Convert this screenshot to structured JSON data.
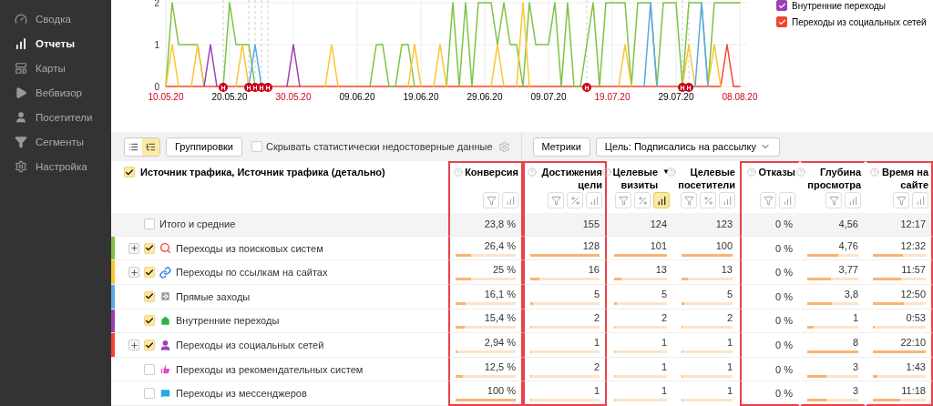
{
  "sidebar": {
    "items": [
      {
        "label": "Сводка",
        "kind": "gauge",
        "selected": false
      },
      {
        "label": "Отчеты",
        "kind": "reports",
        "selected": true
      },
      {
        "label": "Карты",
        "kind": "maps",
        "selected": false
      },
      {
        "label": "Вебвизор",
        "kind": "player",
        "selected": false
      },
      {
        "label": "Посетители",
        "kind": "visitors",
        "selected": false
      },
      {
        "label": "Сегменты",
        "kind": "segments",
        "selected": false
      },
      {
        "label": "Настройка",
        "kind": "settings",
        "selected": false
      }
    ]
  },
  "chart": {
    "chart_data": {
      "type": "line",
      "categories": [
        "10.05.20",
        null,
        null,
        null,
        null,
        null,
        null,
        null,
        null,
        null,
        "20.05.20",
        null,
        null,
        null,
        null,
        null,
        null,
        null,
        null,
        null,
        "30.05.20",
        null,
        null,
        null,
        null,
        null,
        null,
        null,
        null,
        null,
        "09.06.20",
        null,
        null,
        null,
        null,
        null,
        null,
        null,
        null,
        null,
        "19.06.20",
        null,
        null,
        null,
        null,
        null,
        null,
        null,
        null,
        null,
        "29.06.20",
        null,
        null,
        null,
        null,
        null,
        null,
        null,
        null,
        null,
        "09.07.20",
        null,
        null,
        null,
        null,
        null,
        null,
        null,
        null,
        null,
        "19.07.20",
        null,
        null,
        null,
        null,
        null,
        null,
        null,
        null,
        null,
        "29.07.20",
        null,
        null,
        null,
        null,
        null,
        null,
        null,
        null,
        null,
        "08.08.20"
      ],
      "ylim": [
        0,
        2
      ],
      "yticks": [
        0,
        1,
        2
      ],
      "series": [
        {
          "color": "#f4442e",
          "values": [
            0,
            0,
            0,
            0,
            0,
            0,
            0,
            0,
            0,
            0,
            0,
            0,
            0,
            0,
            0,
            0,
            0,
            0,
            0,
            0,
            0,
            0,
            0,
            0,
            0,
            0,
            0,
            0,
            0,
            0,
            0,
            0,
            0,
            0,
            0,
            0,
            0,
            0,
            0,
            0,
            0,
            0,
            0,
            0,
            0,
            0,
            0,
            0,
            0,
            0,
            0,
            0,
            0,
            0,
            0,
            0,
            0,
            0,
            0,
            0,
            0,
            0,
            0,
            0,
            0,
            0,
            0,
            0,
            0,
            0,
            0,
            0,
            0,
            0,
            0,
            0,
            0,
            0,
            0,
            0,
            0,
            0,
            0,
            0,
            0,
            0,
            0,
            0,
            1,
            0,
            0
          ]
        },
        {
          "color": "#7dc242",
          "values": [
            0,
            2,
            1,
            1,
            1,
            1,
            0,
            null,
            null,
            0,
            2,
            1,
            1,
            1,
            0,
            null,
            null,
            null,
            null,
            null,
            null,
            null,
            null,
            null,
            null,
            null,
            null,
            null,
            null,
            null,
            null,
            null,
            0,
            1,
            1,
            0,
            0,
            1,
            1,
            0,
            null,
            null,
            null,
            null,
            0,
            2,
            0,
            2,
            0,
            2,
            2,
            2,
            1,
            2,
            1,
            1,
            0,
            2,
            1,
            1,
            1,
            2,
            0,
            2,
            0,
            0,
            1,
            2,
            0,
            2,
            2,
            2,
            2,
            0,
            2,
            2,
            2,
            0,
            2,
            2,
            2,
            0,
            2,
            2,
            2,
            0,
            2,
            2,
            2,
            2,
            2
          ]
        },
        {
          "color": "#fcc52d",
          "values": [
            0,
            1,
            0,
            null,
            0,
            1,
            0,
            null,
            null,
            null,
            null,
            0,
            1,
            0,
            null,
            null,
            null,
            null,
            null,
            null,
            null,
            null,
            null,
            null,
            null,
            0,
            1,
            0,
            null,
            null,
            null,
            null,
            null,
            null,
            null,
            null,
            null,
            null,
            0,
            1,
            0,
            null,
            0,
            1,
            0,
            null,
            null,
            null,
            null,
            null,
            null,
            0,
            1,
            0,
            null,
            0,
            2,
            0,
            null,
            null,
            null,
            null,
            null,
            null,
            null,
            null,
            null,
            null,
            null,
            null,
            null,
            0,
            1,
            0,
            null,
            null,
            null,
            null,
            null,
            null,
            null,
            0,
            1,
            0,
            null,
            0,
            1,
            0,
            null,
            null,
            null
          ]
        },
        {
          "color": "#5aa9e6",
          "values": [
            null,
            null,
            null,
            null,
            null,
            null,
            null,
            null,
            null,
            null,
            null,
            null,
            null,
            0,
            1,
            0,
            null,
            null,
            null,
            null,
            null,
            null,
            null,
            null,
            null,
            null,
            null,
            null,
            null,
            null,
            null,
            null,
            null,
            null,
            null,
            null,
            null,
            null,
            null,
            null,
            null,
            null,
            null,
            null,
            null,
            null,
            null,
            null,
            null,
            null,
            null,
            null,
            null,
            null,
            null,
            null,
            null,
            null,
            null,
            null,
            null,
            null,
            null,
            null,
            null,
            null,
            null,
            null,
            null,
            null,
            null,
            null,
            null,
            null,
            null,
            0,
            2,
            0,
            null,
            null,
            null,
            null,
            null,
            0,
            2,
            0,
            null,
            null,
            null,
            null,
            null
          ]
        },
        {
          "type": "scatter",
          "color": "#c8001a",
          "values": [
            null,
            null,
            null,
            null,
            null,
            null,
            null,
            null,
            null,
            0,
            null,
            null,
            null,
            0,
            0,
            0,
            0,
            null,
            null,
            null,
            null,
            null,
            null,
            null,
            null,
            null,
            null,
            null,
            null,
            null,
            null,
            null,
            null,
            null,
            null,
            null,
            null,
            null,
            null,
            null,
            null,
            null,
            null,
            null,
            null,
            null,
            null,
            null,
            null,
            null,
            null,
            null,
            null,
            null,
            null,
            null,
            null,
            null,
            null,
            null,
            null,
            null,
            null,
            null,
            null,
            null,
            0,
            null,
            null,
            null,
            null,
            null,
            null,
            null,
            null,
            null,
            null,
            null,
            null,
            null,
            null,
            0,
            0,
            null,
            null,
            null,
            null,
            null,
            null,
            null,
            null
          ]
        },
        {
          "color": "#9c3fb5",
          "values": [
            null,
            null,
            null,
            null,
            null,
            null,
            0,
            1,
            0,
            null,
            null,
            null,
            null,
            null,
            null,
            null,
            null,
            null,
            null,
            0,
            1,
            0,
            null,
            null,
            null,
            null,
            null,
            null,
            null,
            null,
            null,
            null,
            null,
            null,
            null,
            null,
            null,
            null,
            null,
            null,
            null,
            null,
            null,
            null,
            null,
            null,
            null,
            null,
            null,
            null,
            null,
            null,
            null,
            null,
            null,
            null,
            null,
            null,
            null,
            null,
            null,
            null,
            null,
            null,
            null,
            null,
            null,
            null,
            null,
            null,
            null,
            null,
            null,
            null,
            null,
            null,
            null,
            null,
            null,
            null,
            null,
            null,
            null,
            null,
            null,
            null,
            null,
            null,
            null,
            null,
            null
          ]
        }
      ],
      "grid": true
    },
    "holiday_labels": [
      "Н",
      "Н",
      "Н",
      "Н",
      "Н",
      "Н",
      "Н",
      "Н"
    ],
    "date_labels": [
      {
        "weekend": true
      },
      {
        "weekend": false
      },
      {
        "weekend": true
      },
      {
        "weekend": false
      },
      {
        "weekend": false
      },
      {
        "weekend": false
      },
      {
        "weekend": false
      },
      {
        "weekend": true
      },
      {
        "weekend": false
      },
      {
        "weekend": true
      }
    ],
    "legend": [
      {
        "label": "Внутренние переходы",
        "color": "#9c3fb5",
        "checked": true
      },
      {
        "label": "Переходы из социальных сетей",
        "color": "#f4442e",
        "checked": true
      }
    ]
  },
  "toolbar": {
    "view_toggles": [
      {
        "kind": "list",
        "selected": false
      },
      {
        "kind": "tree",
        "selected": true
      }
    ],
    "groupings_button": "Группировки",
    "hide_unreliable": {
      "label": "Скрывать статистически недостоверные данные",
      "checked": false
    },
    "metrics_button": "Метрики",
    "goal_select": "Цель: Подписались на рассылку"
  },
  "table": {
    "dimension_header": {
      "label": "Источник трафика, Источник трафика (детально)",
      "checked": true
    },
    "column_groups": [
      {
        "highlighted": true,
        "columns": [
          {
            "title": "Конверсия",
            "buttons": [
              {
                "kind": "filter",
                "selected": false
              },
              {
                "kind": "chart",
                "selected": false
              }
            ]
          }
        ]
      },
      {
        "highlighted": true,
        "columns": [
          {
            "title": "Достижения цели",
            "buttons": [
              {
                "kind": "filter",
                "selected": false
              },
              {
                "kind": "percent",
                "selected": false
              },
              {
                "kind": "chart",
                "selected": false
              }
            ]
          }
        ]
      },
      {
        "highlighted": false,
        "columns": [
          {
            "title": "Целевые визиты",
            "sort": "▼",
            "buttons": [
              {
                "kind": "filter",
                "selected": false
              },
              {
                "kind": "percent",
                "selected": false
              },
              {
                "kind": "chart",
                "selected": true
              }
            ]
          },
          {
            "title": "Целевые посетители",
            "buttons": [
              {
                "kind": "filter",
                "selected": false
              },
              {
                "kind": "percent",
                "selected": false
              },
              {
                "kind": "chart",
                "selected": false
              }
            ]
          }
        ]
      },
      {
        "highlighted": true,
        "columns": [
          {
            "title": "Отказы",
            "buttons": [
              {
                "kind": "filter",
                "selected": false
              },
              {
                "kind": "chart",
                "selected": false
              }
            ]
          },
          {
            "title": "Глубина просмотра",
            "buttons": [
              {
                "kind": "filter",
                "selected": false
              },
              {
                "kind": "chart",
                "selected": false
              }
            ]
          },
          {
            "title": "Время на сайте",
            "buttons": [
              {
                "kind": "filter",
                "selected": false
              },
              {
                "kind": "chart",
                "selected": false
              }
            ]
          }
        ]
      }
    ],
    "rows": [
      {
        "kind": "total",
        "label": "Итого и средние",
        "checked": false,
        "expandable": false,
        "cells": [
          {
            "value": "23,8 %"
          },
          {
            "value": "155"
          },
          {
            "value": "124"
          },
          {
            "value": "123"
          },
          {
            "value": "0 %"
          },
          {
            "value": "4,56"
          },
          {
            "value": "12:17"
          }
        ]
      },
      {
        "kind": "search",
        "label": "Переходы из поисковых систем",
        "color": "#7dc242",
        "checked": true,
        "expandable": true,
        "cells": [
          {
            "value": "26,4 %",
            "level": 0.264
          },
          {
            "value": "128",
            "level": 1
          },
          {
            "value": "101",
            "level": 1
          },
          {
            "value": "100",
            "level": 1
          },
          {
            "value": "0 %"
          },
          {
            "value": "4,76",
            "level": 0.6
          },
          {
            "value": "12:32",
            "level": 0.57
          }
        ]
      },
      {
        "kind": "links",
        "label": "Переходы по ссылкам на сайтах",
        "color": "#fcc52d",
        "checked": true,
        "expandable": true,
        "cells": [
          {
            "value": "25 %",
            "level": 0.25
          },
          {
            "value": "16",
            "level": 0.125
          },
          {
            "value": "13",
            "level": 0.13
          },
          {
            "value": "13",
            "level": 0.13
          },
          {
            "value": "0 %"
          },
          {
            "value": "3,77",
            "level": 0.47
          },
          {
            "value": "11:57",
            "level": 0.54
          }
        ]
      },
      {
        "kind": "direct",
        "label": "Прямые заходы",
        "color": "#5aa9e6",
        "checked": true,
        "expandable": false,
        "cells": [
          {
            "value": "16,1 %",
            "level": 0.161
          },
          {
            "value": "5",
            "level": 0.04
          },
          {
            "value": "5",
            "level": 0.05
          },
          {
            "value": "5",
            "level": 0.05
          },
          {
            "value": "0 %"
          },
          {
            "value": "3,8",
            "level": 0.475
          },
          {
            "value": "12:50",
            "level": 0.58
          }
        ]
      },
      {
        "kind": "internal",
        "label": "Внутренние переходы",
        "color": "#9c3fb5",
        "checked": true,
        "expandable": false,
        "cells": [
          {
            "value": "15,4 %",
            "level": 0.154
          },
          {
            "value": "2",
            "level": 0.016
          },
          {
            "value": "2",
            "level": 0.02
          },
          {
            "value": "2",
            "level": 0.02
          },
          {
            "value": "0 %"
          },
          {
            "value": "1",
            "level": 0.125
          },
          {
            "value": "0:53",
            "level": 0.04
          }
        ]
      },
      {
        "kind": "social",
        "label": "Переходы из социальных сетей",
        "color": "#f4442e",
        "checked": true,
        "expandable": true,
        "cells": [
          {
            "value": "2,94 %",
            "level": 0.029
          },
          {
            "value": "1",
            "level": 0.008
          },
          {
            "value": "1",
            "level": 0.01
          },
          {
            "value": "1",
            "level": 0.01
          },
          {
            "value": "0 %"
          },
          {
            "value": "8",
            "level": 1
          },
          {
            "value": "22:10",
            "level": 1
          }
        ]
      },
      {
        "kind": "recommend",
        "label": "Переходы из рекомендательных систем",
        "checked": false,
        "expandable": false,
        "cells": [
          {
            "value": "12,5 %",
            "level": 0.125
          },
          {
            "value": "2",
            "level": 0.016
          },
          {
            "value": "1",
            "level": 0.01
          },
          {
            "value": "1",
            "level": 0.01
          },
          {
            "value": "0 %"
          },
          {
            "value": "3",
            "level": 0.375
          },
          {
            "value": "1:43",
            "level": 0.08
          }
        ]
      },
      {
        "kind": "messenger",
        "label": "Переходы из мессенджеров",
        "checked": false,
        "expandable": false,
        "cells": [
          {
            "value": "100 %",
            "level": 1
          },
          {
            "value": "1",
            "level": 0.008
          },
          {
            "value": "1",
            "level": 0.01
          },
          {
            "value": "1",
            "level": 0.01
          },
          {
            "value": "0 %"
          },
          {
            "value": "3",
            "level": 0.375
          },
          {
            "value": "11:18",
            "level": 0.51
          }
        ]
      }
    ]
  }
}
